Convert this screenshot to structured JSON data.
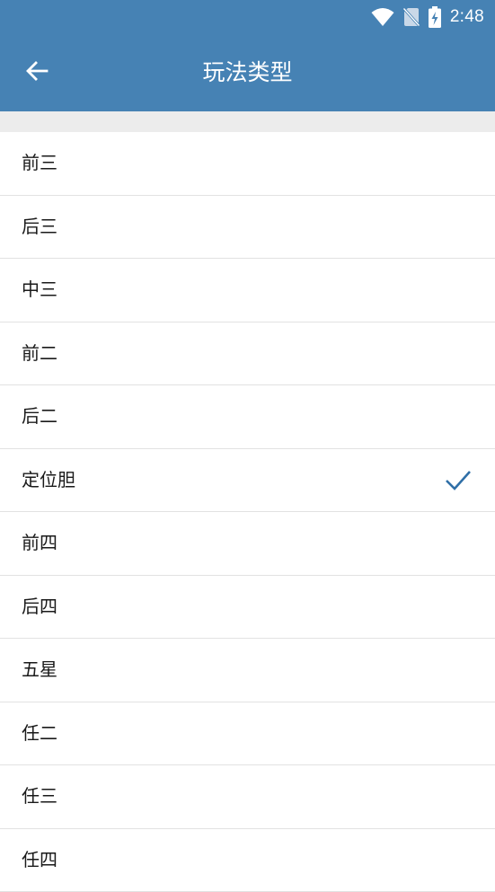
{
  "status_bar": {
    "time": "2:48",
    "icons": [
      "wifi-icon",
      "no-sim-icon",
      "battery-charging-icon"
    ]
  },
  "toolbar": {
    "back_icon": "arrow-back-icon",
    "title": "玩法类型"
  },
  "colors": {
    "primary": "#4682b4",
    "check": "#2f6fa7",
    "divider": "#e2e2e2",
    "band": "#ececec"
  },
  "options": [
    {
      "label": "前三",
      "selected": false
    },
    {
      "label": "后三",
      "selected": false
    },
    {
      "label": "中三",
      "selected": false
    },
    {
      "label": "前二",
      "selected": false
    },
    {
      "label": "后二",
      "selected": false
    },
    {
      "label": "定位胆",
      "selected": true
    },
    {
      "label": "前四",
      "selected": false
    },
    {
      "label": "后四",
      "selected": false
    },
    {
      "label": "五星",
      "selected": false
    },
    {
      "label": "任二",
      "selected": false
    },
    {
      "label": "任三",
      "selected": false
    },
    {
      "label": "任四",
      "selected": false
    }
  ]
}
